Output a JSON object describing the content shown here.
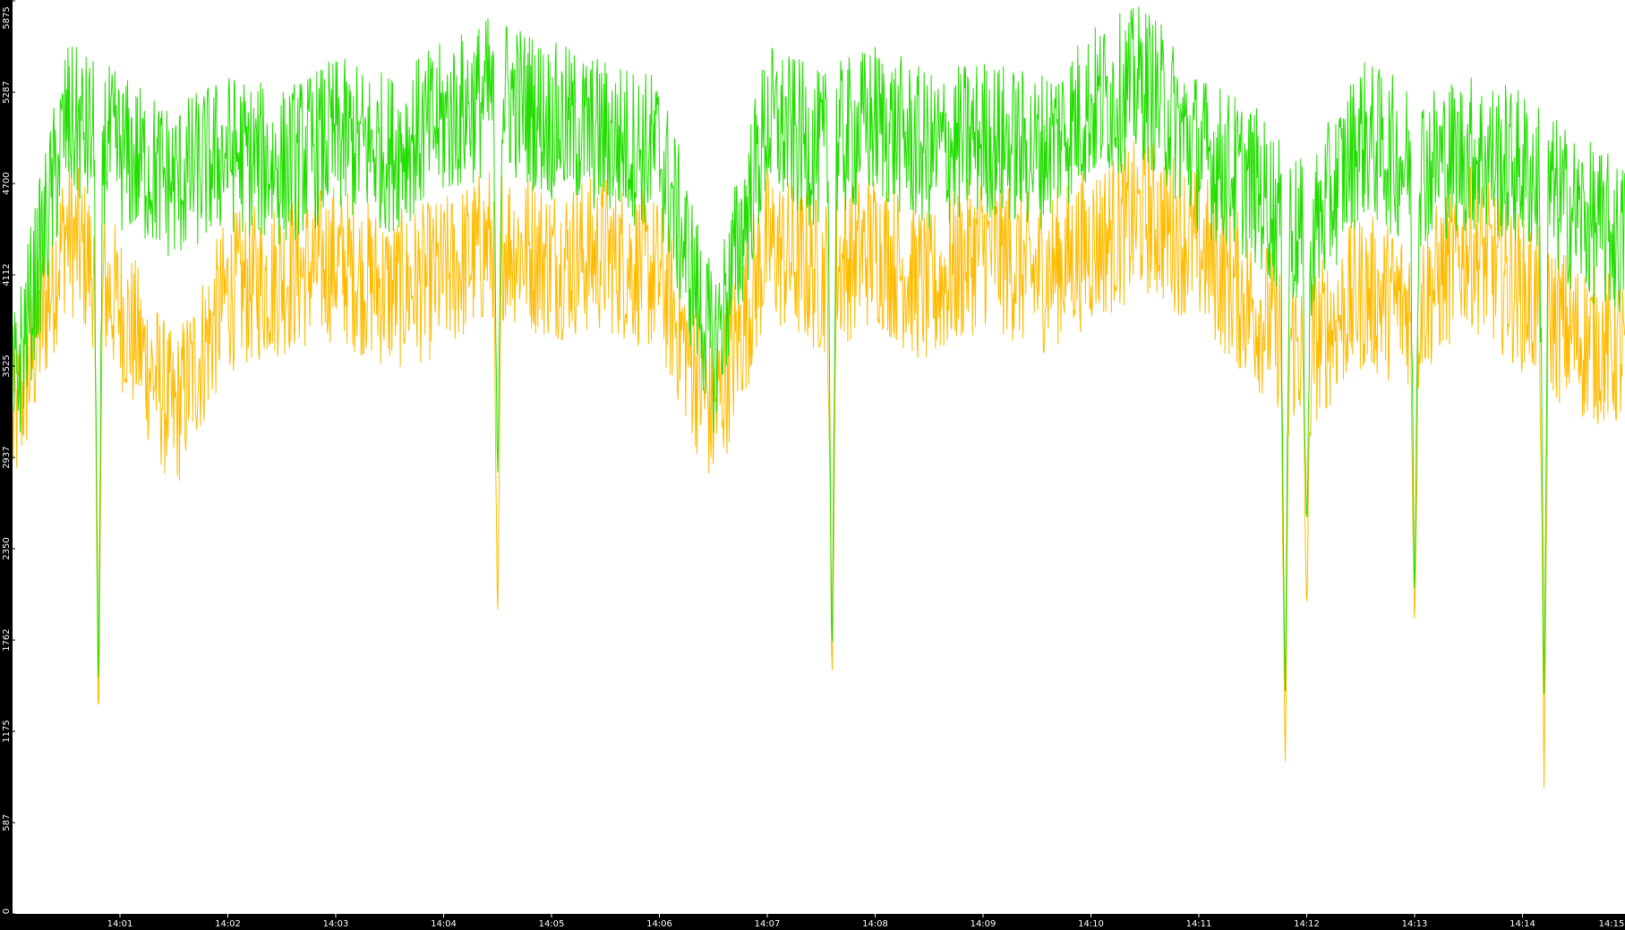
{
  "colors": {
    "background": "#ffffff",
    "axis_band": "#000000",
    "tick_text": "#ffffff",
    "series_green": "#22dd00",
    "series_orange": "#ffbb00"
  },
  "chart_data": {
    "type": "line",
    "title": "",
    "xlabel": "",
    "ylabel": "",
    "ylim": [
      0,
      5875
    ],
    "xlim_minutes": [
      0,
      15
    ],
    "y_ticks": [
      "0",
      "587",
      "1175",
      "1762",
      "2350",
      "2937",
      "3525",
      "4112",
      "4700",
      "5287",
      "5875"
    ],
    "x_ticks": [
      "14:01",
      "14:02",
      "14:03",
      "14:04",
      "14:05",
      "14:06",
      "14:07",
      "14:08",
      "14:09",
      "14:10",
      "14:11",
      "14:12",
      "14:13",
      "14:14",
      "14:15"
    ],
    "grid": false,
    "legend": "none",
    "series": [
      {
        "color": "#22dd00",
        "segments": [
          [
            0.0,
            3300
          ],
          [
            0.5,
            5100
          ],
          [
            1.0,
            4900
          ],
          [
            1.5,
            4700
          ],
          [
            2.0,
            4900
          ],
          [
            2.5,
            4800
          ],
          [
            3.0,
            5000
          ],
          [
            3.5,
            4900
          ],
          [
            4.0,
            5100
          ],
          [
            4.5,
            5300
          ],
          [
            5.0,
            5100
          ],
          [
            5.5,
            5000
          ],
          [
            6.0,
            4900
          ],
          [
            6.5,
            3600
          ],
          [
            7.0,
            5100
          ],
          [
            7.5,
            4900
          ],
          [
            8.0,
            5100
          ],
          [
            8.5,
            4900
          ],
          [
            9.0,
            5000
          ],
          [
            9.5,
            4900
          ],
          [
            10.0,
            5200
          ],
          [
            10.5,
            5350
          ],
          [
            11.0,
            4900
          ],
          [
            11.5,
            4700
          ],
          [
            12.0,
            4300
          ],
          [
            12.5,
            5000
          ],
          [
            13.0,
            4800
          ],
          [
            13.5,
            4900
          ],
          [
            14.0,
            4800
          ],
          [
            14.5,
            4500
          ],
          [
            15.0,
            4300
          ]
        ]
      },
      {
        "color": "#ffbb00",
        "segments": [
          [
            0.0,
            3100
          ],
          [
            0.5,
            4400
          ],
          [
            1.0,
            3900
          ],
          [
            1.5,
            3200
          ],
          [
            2.0,
            4000
          ],
          [
            2.5,
            4100
          ],
          [
            3.0,
            4200
          ],
          [
            3.5,
            4000
          ],
          [
            4.0,
            4100
          ],
          [
            4.5,
            4350
          ],
          [
            5.0,
            4200
          ],
          [
            5.5,
            4250
          ],
          [
            6.0,
            4100
          ],
          [
            6.5,
            3200
          ],
          [
            7.0,
            4300
          ],
          [
            7.5,
            4100
          ],
          [
            8.0,
            4300
          ],
          [
            8.5,
            4000
          ],
          [
            9.0,
            4300
          ],
          [
            9.5,
            4100
          ],
          [
            10.0,
            4300
          ],
          [
            10.5,
            4500
          ],
          [
            11.0,
            4300
          ],
          [
            11.5,
            3900
          ],
          [
            12.0,
            3600
          ],
          [
            12.5,
            4000
          ],
          [
            13.0,
            3900
          ],
          [
            13.5,
            4300
          ],
          [
            14.0,
            4000
          ],
          [
            14.5,
            3700
          ],
          [
            15.0,
            3600
          ]
        ]
      }
    ],
    "dips": [
      {
        "x": 0.8,
        "green": 1250,
        "orange": 1150
      },
      {
        "x": 4.5,
        "green": 2700,
        "orange": 1800
      },
      {
        "x": 7.6,
        "green": 1550,
        "orange": 1400
      },
      {
        "x": 11.8,
        "green": 1300,
        "orange": 850
      },
      {
        "x": 12.0,
        "green": 2400,
        "orange": 1900
      },
      {
        "x": 13.0,
        "green": 1950,
        "orange": 1800
      },
      {
        "x": 14.2,
        "green": 1400,
        "orange": 800
      }
    ]
  }
}
